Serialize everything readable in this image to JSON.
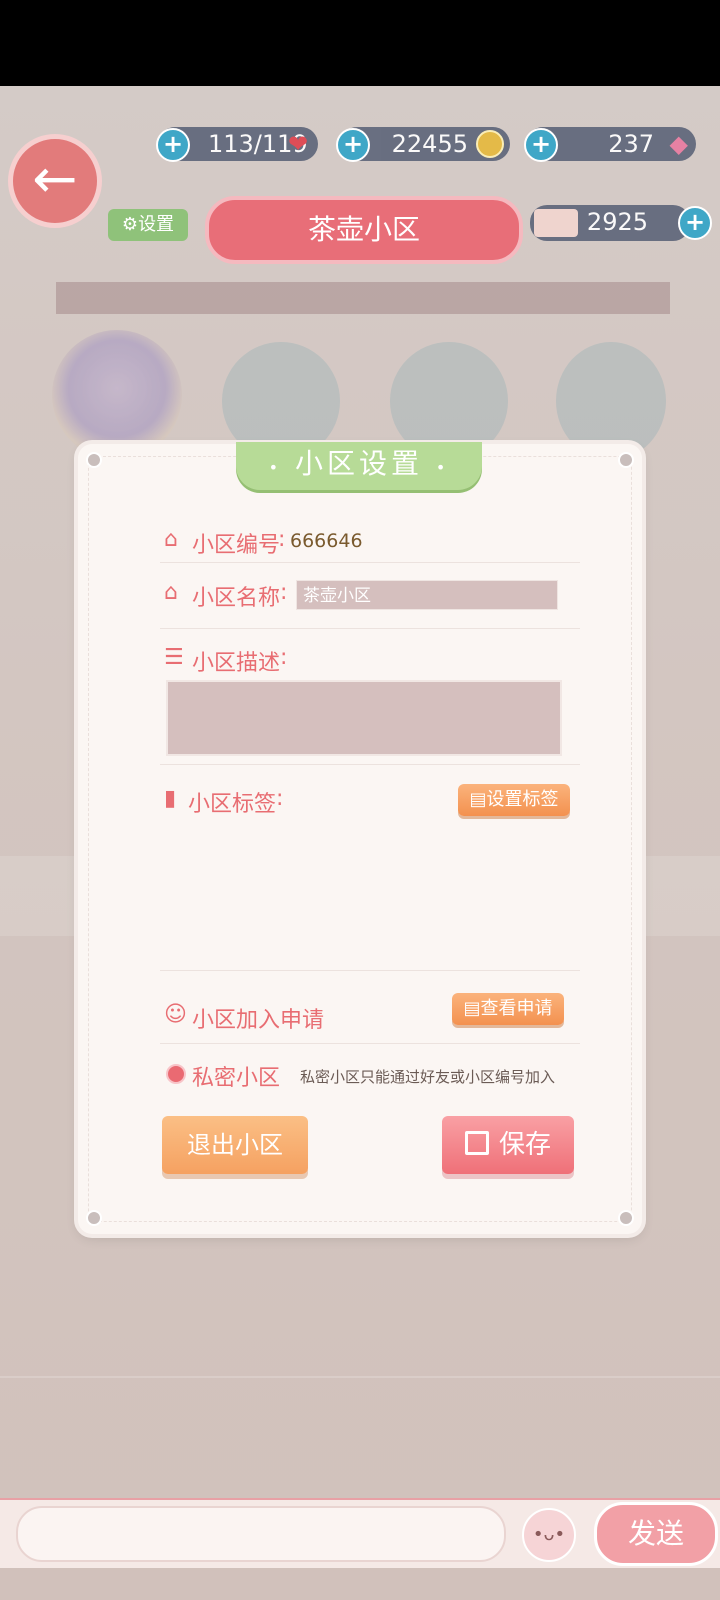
{
  "topbar": {
    "stamina": "113/119",
    "coins": "22455",
    "gems": "237",
    "tickets": "2925",
    "settings_label": "设置",
    "community_title": "茶壶小区"
  },
  "modal": {
    "title": "小区设置",
    "id_label": "小区编号",
    "id_value": "666646",
    "name_label": "小区名称",
    "name_value": "茶壶小区",
    "desc_label": "小区描述",
    "desc_value": "",
    "tags_label": "小区标签",
    "set_tags_button": "设置标签",
    "join_requests_label": "小区加入申请",
    "view_requests_button": "查看申请",
    "private_label": "私密小区",
    "private_hint": "私密小区只能通过好友或小区编号加入",
    "leave_button": "退出小区",
    "save_button": "保存"
  },
  "chat": {
    "input_placeholder": "",
    "send_button": "发送"
  }
}
